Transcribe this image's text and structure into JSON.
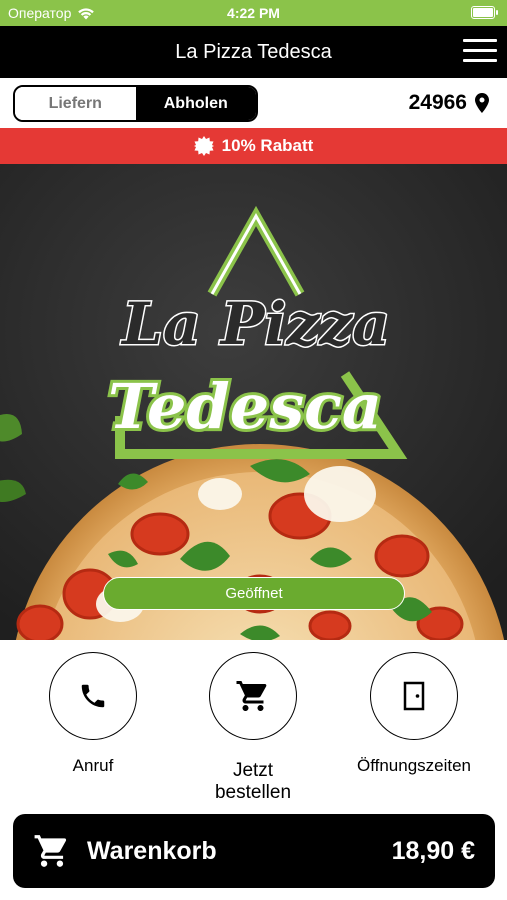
{
  "status_bar": {
    "carrier": "Оператор",
    "time": "4:22 PM"
  },
  "header": {
    "title": "La Pizza Tedesca"
  },
  "order_mode": {
    "deliver_label": "Liefern",
    "pickup_label": "Abholen",
    "selected": "Abholen"
  },
  "location": {
    "postal_code": "24966"
  },
  "discount": {
    "text": "10% Rabatt"
  },
  "hero": {
    "logo_line1": "La Pizza",
    "logo_line2": "Tedesca",
    "open_status": "Geöffnet"
  },
  "actions": [
    {
      "label": "Anruf",
      "icon": "phone-icon"
    },
    {
      "label": "Jetzt bestellen",
      "icon": "cart-icon"
    },
    {
      "label": "Öffnungszeiten",
      "icon": "door-icon"
    }
  ],
  "cart": {
    "label": "Warenkorb",
    "total": "18,90 €"
  },
  "colors": {
    "brand_green": "#8bc34a",
    "discount_red": "#e53935",
    "open_green": "#6aab2f",
    "dark": "#000000"
  }
}
